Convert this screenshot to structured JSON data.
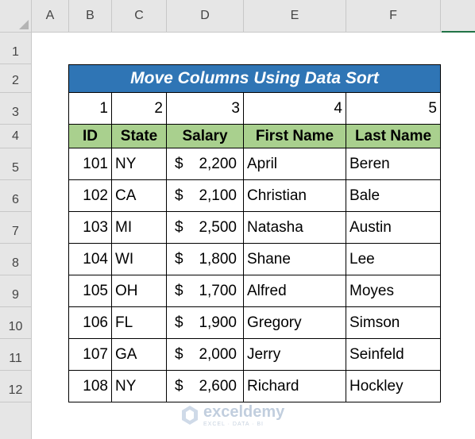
{
  "spreadsheet": {
    "columns": [
      "A",
      "B",
      "C",
      "D",
      "E",
      "F"
    ],
    "rows": [
      "1",
      "2",
      "3",
      "4",
      "5",
      "6",
      "7",
      "8",
      "9",
      "10",
      "11",
      "12"
    ],
    "colors": {
      "title_bg": "#2f75b5",
      "header_bg": "#a9d08e",
      "selection_accent": "#217346"
    }
  },
  "table": {
    "title": "Move Columns Using Data Sort",
    "sort_numbers": [
      "1",
      "2",
      "3",
      "4",
      "5"
    ],
    "headers": [
      "ID",
      "State",
      "Salary",
      "First Name",
      "Last Name"
    ],
    "currency_symbol": "$",
    "rows": [
      {
        "id": "101",
        "state": "NY",
        "salary": "2,200",
        "first": "April",
        "last": "Beren"
      },
      {
        "id": "102",
        "state": "CA",
        "salary": "2,100",
        "first": "Christian",
        "last": "Bale"
      },
      {
        "id": "103",
        "state": "MI",
        "salary": "2,500",
        "first": "Natasha",
        "last": "Austin"
      },
      {
        "id": "104",
        "state": "WI",
        "salary": "1,800",
        "first": "Shane",
        "last": "Lee"
      },
      {
        "id": "105",
        "state": "OH",
        "salary": "1,700",
        "first": "Alfred",
        "last": "Moyes"
      },
      {
        "id": "106",
        "state": "FL",
        "salary": "1,900",
        "first": "Gregory",
        "last": "Simson"
      },
      {
        "id": "107",
        "state": "GA",
        "salary": "2,000",
        "first": "Jerry",
        "last": "Seinfeld"
      },
      {
        "id": "108",
        "state": "NY",
        "salary": "2,600",
        "first": "Richard",
        "last": "Hockley"
      }
    ]
  },
  "watermark": {
    "icon": "exceldemy-logo-icon",
    "name": "exceldemy",
    "tagline": "EXCEL · DATA · BI"
  }
}
